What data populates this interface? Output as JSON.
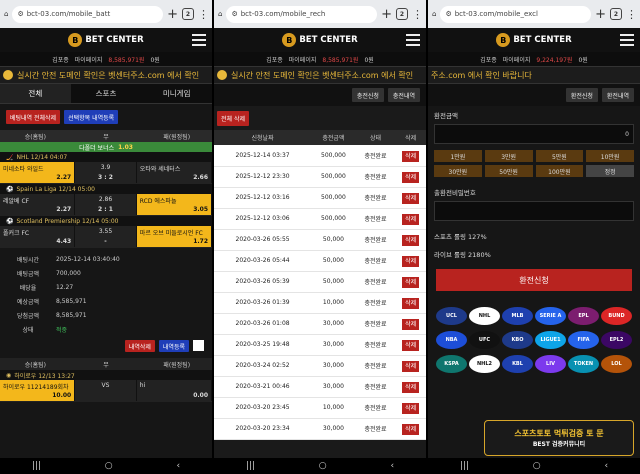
{
  "panel1": {
    "url": "bct-03.com/mobile_batt",
    "tab_count": "2",
    "logo": "BET CENTER",
    "user": "김포종",
    "mypage": "마이페이지",
    "money": "8,585,971원",
    "points": "0원",
    "marquee": "실시간 안전 도메인 확인은 벳센터주소.com 에서 확인",
    "tabs": [
      "전체",
      "스포츠",
      "미니게임"
    ],
    "buttons": [
      "베팅내역 전체삭제",
      "선택항목 내역등록"
    ],
    "col_headers": [
      "승(홈팀)",
      "무",
      "패(원정팀)"
    ],
    "bonus": {
      "label": "다폴더 보너스",
      "value": "1.03"
    },
    "matches": [
      {
        "league": "NHL 12/14 04:07",
        "home": "미네소타 와일드",
        "home_odd": "2.27",
        "mid": "3.9",
        "mid_odd": "3 : 2",
        "away": "오타와 세네터스",
        "away_odd": "2.66"
      },
      {
        "league": "Spain La Liga 12/14 05:00",
        "home": "레알베 CF",
        "home_odd": "2.27",
        "mid": "2.86",
        "mid_odd": "2 : 1",
        "away": "RCD 에스파뇰",
        "away_odd": "3.05"
      },
      {
        "league": "Scotland Premiership 12/14 05:00",
        "home": "폴커크 FC",
        "home_odd": "4.43",
        "mid": "3.55",
        "mid_odd": "-",
        "away": "마르 오브 미들로시언 FC",
        "away_odd": "1.72"
      }
    ],
    "info": [
      {
        "k": "배팅시간",
        "v": "2025-12-14 03:40:40"
      },
      {
        "k": "배팅금액",
        "v": "700,000"
      },
      {
        "k": "배당율",
        "v": "12.27"
      },
      {
        "k": "예상금액",
        "v": "8,585,971"
      },
      {
        "k": "당첨금액",
        "v": "8,585,971"
      },
      {
        "k": "상태",
        "v": "적중"
      }
    ],
    "action_buttons": [
      "내역삭제",
      "내역등록"
    ],
    "bottom_league": "하이로우 12/13 13:27",
    "bottom_home": "하이로우 11214189회차",
    "bottom_home_odd": "10.00",
    "bottom_mid": "VS",
    "bottom_away": "hi",
    "bottom_away_odd": "0.00"
  },
  "panel2": {
    "url": "bct-03.com/mobile_rech",
    "tab_count": "2",
    "logo": "BET CENTER",
    "user": "김포종",
    "mypage": "마이페이지",
    "money": "8,585,971원",
    "points": "0원",
    "marquee": "실시간 안전 도메인 확인은 벳센터주소.com 에서 확인",
    "tabs": [
      "충전신청",
      "충전내역"
    ],
    "select_delete": "전체 삭제",
    "headers": [
      "신청날짜",
      "충전금액",
      "상태",
      "삭제"
    ],
    "rows": [
      [
        "2025-12-14 03:37",
        "500,000",
        "충전완료",
        "삭제"
      ],
      [
        "2025-12-12 23:30",
        "500,000",
        "충전완료",
        "삭제"
      ],
      [
        "2025-12-12 03:16",
        "500,000",
        "충전완료",
        "삭제"
      ],
      [
        "2025-12-12 03:06",
        "500,000",
        "충전완료",
        "삭제"
      ],
      [
        "2020-03-26 05:55",
        "50,000",
        "충전완료",
        "삭제"
      ],
      [
        "2020-03-26 05:44",
        "50,000",
        "충전완료",
        "삭제"
      ],
      [
        "2020-03-26 05:39",
        "50,000",
        "충전완료",
        "삭제"
      ],
      [
        "2020-03-26 01:39",
        "10,000",
        "충전완료",
        "삭제"
      ],
      [
        "2020-03-26 01:08",
        "30,000",
        "충전완료",
        "삭제"
      ],
      [
        "2020-03-25 19:48",
        "30,000",
        "충전완료",
        "삭제"
      ],
      [
        "2020-03-24 02:52",
        "30,000",
        "충전완료",
        "삭제"
      ],
      [
        "2020-03-21 00:46",
        "30,000",
        "충전완료",
        "삭제"
      ],
      [
        "2020-03-20 23:45",
        "10,000",
        "충전완료",
        "삭제"
      ],
      [
        "2020-03-20 23:34",
        "30,000",
        "충전완료",
        "삭제"
      ]
    ]
  },
  "panel3": {
    "url": "bct-03.com/mobile_excl",
    "tab_count": "2",
    "logo": "BET CENTER",
    "user": "김포종",
    "mypage": "마이페이지",
    "money": "9,224,197원",
    "points": "0원",
    "marquee": "주소.com 에서 확인 바랍니다",
    "tabs": [
      "환전신청",
      "환전내역"
    ],
    "amount_label": "환전금액",
    "amount_value": "0",
    "amount_buttons": [
      "1만원",
      "3만원",
      "5만원",
      "10만원",
      "30만원",
      "50만원",
      "100만원",
      "정정"
    ],
    "pw_label": "출환전비밀번호",
    "sports_rolling": "스포츠 롤링 127%",
    "live_rolling": "라이브 롤링 2180%",
    "submit": "환전신청",
    "partners": [
      "UCL",
      "NHL",
      "MLB",
      "SERIE A",
      "EPL",
      "BUND",
      "NBA",
      "UFC",
      "KBO",
      "LIGUE1",
      "FIFA",
      "EPL2",
      "KSPA",
      "NHL2",
      "KBL",
      "LIV",
      "TOKEN",
      "LOL"
    ],
    "watermark_title": "스포츠토토 먹튀검증 토 문",
    "watermark_sub": "BEST 검증커뮤니티"
  }
}
